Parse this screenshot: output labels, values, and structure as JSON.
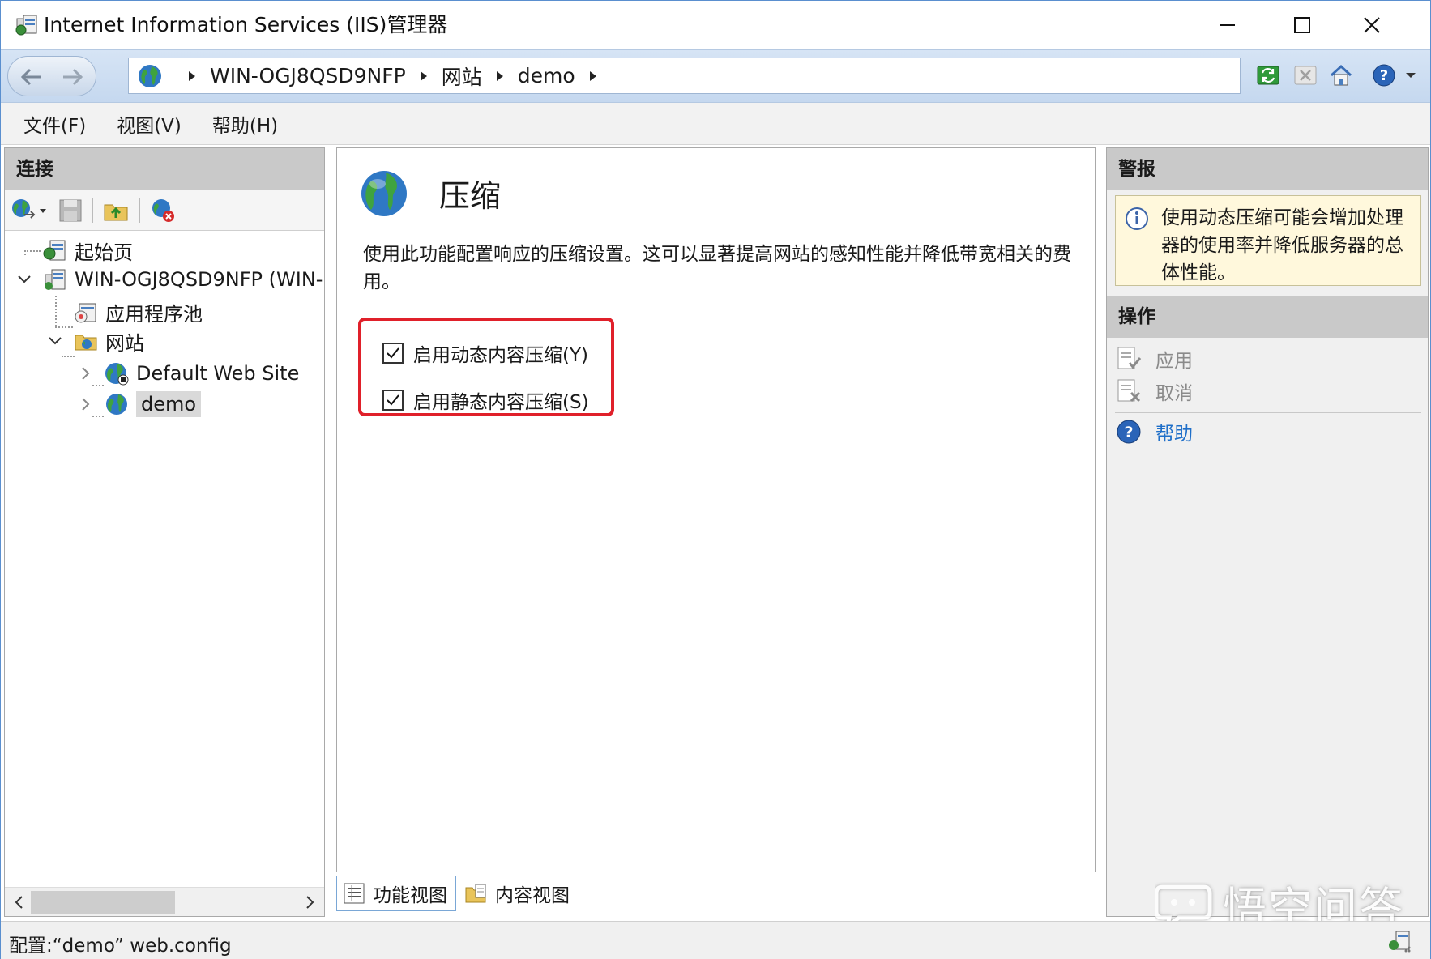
{
  "window": {
    "title": "Internet Information Services (IIS)管理器"
  },
  "address": {
    "crumbs": [
      "WIN-OGJ8QSD9NFP",
      "网站",
      "demo"
    ]
  },
  "menu": {
    "items": [
      "文件(F)",
      "视图(V)",
      "帮助(H)"
    ]
  },
  "connections": {
    "header": "连接",
    "tree": {
      "start_page": "起始页",
      "server": "WIN-OGJ8QSD9NFP (WIN-",
      "app_pools": "应用程序池",
      "sites": "网站",
      "default_site": "Default Web Site",
      "demo": "demo"
    }
  },
  "feature": {
    "title": "压缩",
    "description": "使用此功能配置响应的压缩设置。这可以显著提高网站的感知性能并降低带宽相关的费用。",
    "dynamic_compression": {
      "label": "启用动态内容压缩(Y)",
      "checked": true
    },
    "static_compression": {
      "label": "启用静态内容压缩(S)",
      "checked": true
    },
    "highlight_color": "#e0202a"
  },
  "view_tabs": {
    "features": "功能视图",
    "content": "内容视图",
    "active": "features"
  },
  "alerts": {
    "header": "警报",
    "message": "使用动态压缩可能会增加处理器的使用率并降低服务器的总体性能。"
  },
  "actions": {
    "header": "操作",
    "apply": "应用",
    "cancel": "取消",
    "help": "帮助"
  },
  "status": {
    "text": "配置:“demo” web.config"
  },
  "watermark": {
    "text": "悟空问答"
  },
  "colors": {
    "address_bar": "#c5d8ef",
    "panel_header": "#c9c9c9",
    "alert_bg": "#fff8dc",
    "link": "#1f6fc9"
  }
}
